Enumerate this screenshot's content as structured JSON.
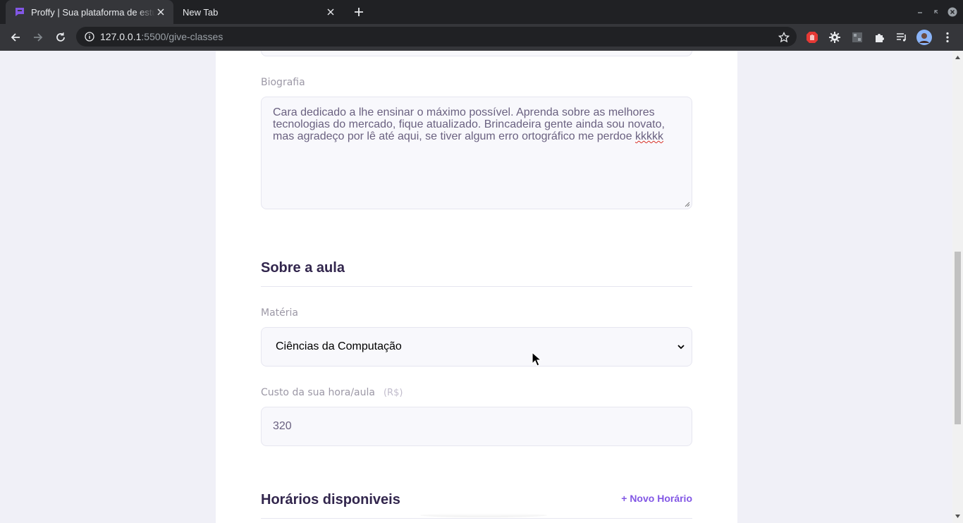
{
  "browser": {
    "tabs": [
      {
        "title": "Proffy | Sua plataforma de estudos online",
        "active": true
      },
      {
        "title": "New Tab",
        "active": false
      }
    ],
    "url_host": "127.0.0.1",
    "url_path": ":5500/give-classes",
    "accent": "#8257e5"
  },
  "form": {
    "bio_label": "Biografia",
    "bio_text_main": "Cara dedicado a lhe ensinar o máximo possível. Aprenda sobre as melhores tecnologias do mercado, fique atualizado. Brincadeira gente ainda sou novato, mas agradeço por lê até aqui, se tiver algum erro ortográfico me perdoe ",
    "bio_text_misspelled": "kkkkk",
    "section_class_title": "Sobre a aula",
    "subject_label": "Matéria",
    "subject_value": "Ciências da Computação",
    "cost_label": "Custo da sua hora/aula",
    "cost_hint": "(R$)",
    "cost_value": "320",
    "section_schedule_title": "Horários disponiveis",
    "new_schedule_label": "+ Novo Horário"
  }
}
